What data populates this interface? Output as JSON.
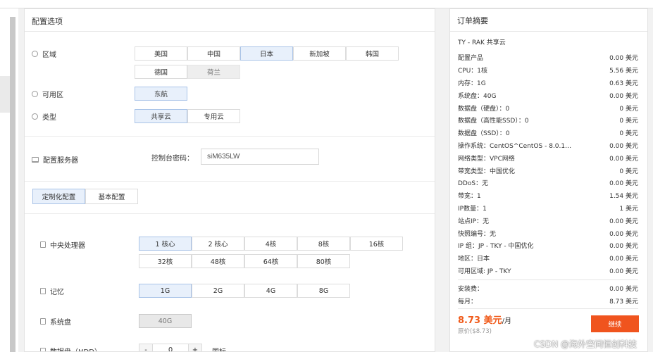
{
  "config": {
    "title": "配置选项",
    "region_label": "区域",
    "regions": [
      "美国",
      "中国",
      "日本",
      "新加坡",
      "韩国",
      "德国",
      "荷兰"
    ],
    "zone_label": "可用区",
    "zones": [
      "东航"
    ],
    "type_label": "类型",
    "types": [
      "共享云",
      "专用云"
    ],
    "server_label": "配置服务器",
    "password_label": "控制台密码：",
    "password_value": "siM635LW",
    "tabs": [
      "定制化配置",
      "基本配置"
    ],
    "cpu_label": "中央处理器",
    "cpu_options": [
      "1 核心",
      "2 核心",
      "4核",
      "8核",
      "16核",
      "32核",
      "48核",
      "64核",
      "80核"
    ],
    "mem_label": "记忆",
    "mem_options": [
      "1G",
      "2G",
      "4G",
      "8G"
    ],
    "disk_label": "系统盘",
    "disk_options": [
      "40G"
    ],
    "hdd_label": "数据盘（HDD）",
    "hdd_minus": "-",
    "hdd_value": "0",
    "hdd_plus": "+",
    "hdd_unit": "国标"
  },
  "summary": {
    "title": "订单摘要",
    "product": "TY - RAK 共享云",
    "lines": [
      {
        "k": "配置产品",
        "v": "0.00 美元"
      },
      {
        "k": "CPU：1核",
        "v": "5.56 美元"
      },
      {
        "k": "内存：1G",
        "v": "0.63 美元"
      },
      {
        "k": "系统盘：40G",
        "v": "0.00 美元"
      },
      {
        "k": "数据盘（硬盘）：0",
        "v": "0 美元"
      },
      {
        "k": "数据盘（高性能SSD）：0",
        "v": "0 美元"
      },
      {
        "k": "数据盘（SSD）：0",
        "v": "0 美元"
      },
      {
        "k": "操作系统：CentOS^CentOS - 8.0.1…",
        "v": "0.00 美元"
      },
      {
        "k": "网络类型：VPC网络",
        "v": "0.00 美元"
      },
      {
        "k": "带宽类型：中国优化",
        "v": "0 美元"
      },
      {
        "k": "DDoS：无",
        "v": "0.00 美元"
      },
      {
        "k": "带宽：1",
        "v": "1.54 美元"
      },
      {
        "k": "IP数量：1",
        "v": "1 美元"
      },
      {
        "k": "站点IP：无",
        "v": "0.00 美元"
      },
      {
        "k": "快照编号：无",
        "v": "0.00 美元"
      },
      {
        "k": "IP 组：JP - TKY - 中国优化",
        "v": "0.00 美元"
      },
      {
        "k": "地区：日本",
        "v": "0.00 美元"
      },
      {
        "k": "可用区域: JP - TKY",
        "v": "0.00 美元"
      }
    ],
    "setup_label": "安装费：",
    "setup_value": "0.00 美元",
    "monthly_label": "每月：",
    "monthly_value": "8.73 美元",
    "price": "8.73 美元",
    "per": "/月",
    "original": "原价($8.73)",
    "continue": "继续"
  },
  "watermark": "CSDN @海外空间恒创科技"
}
